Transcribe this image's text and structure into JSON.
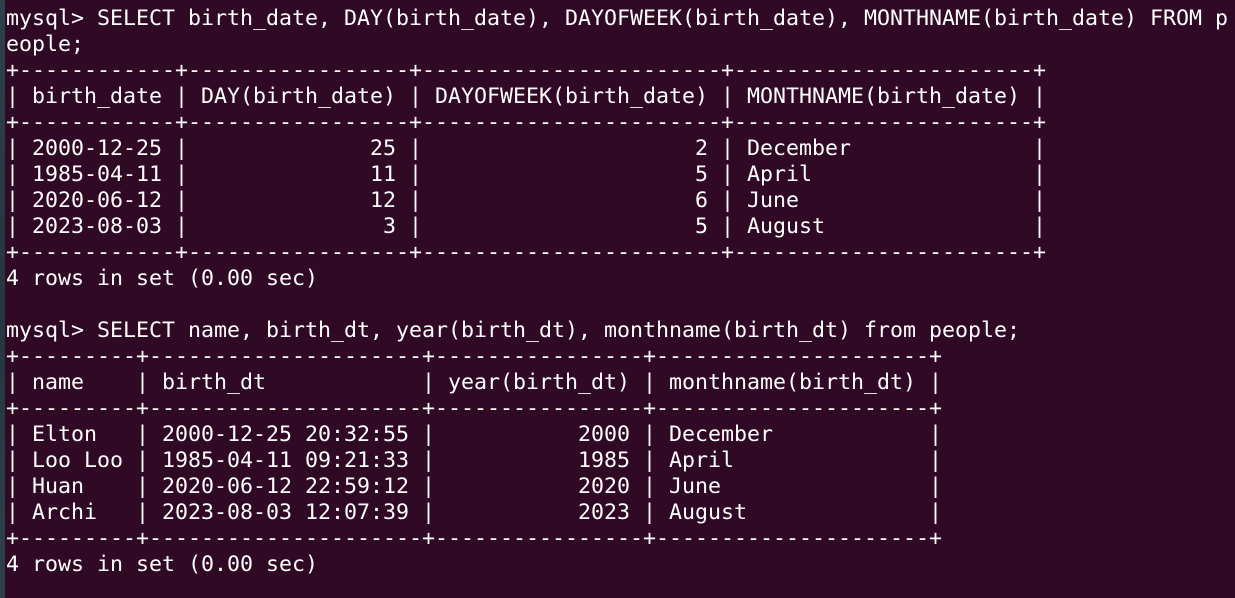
{
  "colors": {
    "background": "#300a24",
    "text": "#ffffff"
  },
  "terminal": {
    "lines": [
      "mysql> SELECT birth_date, DAY(birth_date), DAYOFWEEK(birth_date), MONTHNAME(birth_date) FROM p",
      "eople;",
      "+------------+-----------------+-----------------------+-----------------------+",
      "| birth_date | DAY(birth_date) | DAYOFWEEK(birth_date) | MONTHNAME(birth_date) |",
      "+------------+-----------------+-----------------------+-----------------------+",
      "| 2000-12-25 |              25 |                     2 | December              |",
      "| 1985-04-11 |              11 |                     5 | April                 |",
      "| 2020-06-12 |              12 |                     6 | June                  |",
      "| 2023-08-03 |               3 |                     5 | August                |",
      "+------------+-----------------+-----------------------+-----------------------+",
      "4 rows in set (0.00 sec)",
      "",
      "mysql> SELECT name, birth_dt, year(birth_dt), monthname(birth_dt) from people;",
      "+---------+---------------------+----------------+---------------------+",
      "| name    | birth_dt            | year(birth_dt) | monthname(birth_dt) |",
      "+---------+---------------------+----------------+---------------------+",
      "| Elton   | 2000-12-25 20:32:55 |           2000 | December            |",
      "| Loo Loo | 1985-04-11 09:21:33 |           1985 | April               |",
      "| Huan    | 2020-06-12 22:59:12 |           2020 | June                |",
      "| Archi   | 2023-08-03 12:07:39 |           2023 | August              |",
      "+---------+---------------------+----------------+---------------------+",
      "4 rows in set (0.00 sec)"
    ]
  }
}
